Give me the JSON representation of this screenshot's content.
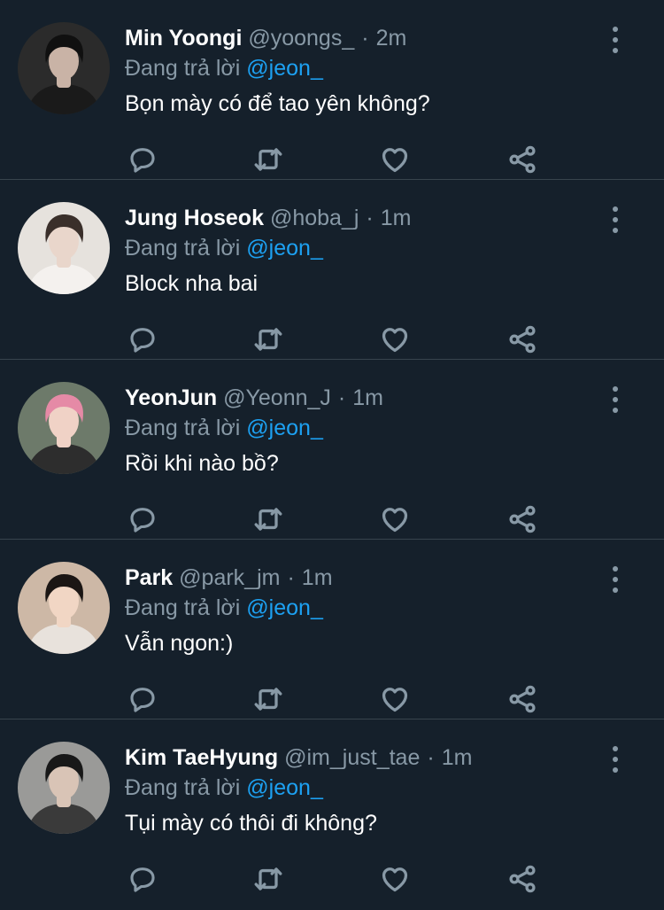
{
  "reply_prefix": "Đang trả lời",
  "time_separator": "·",
  "tweets": [
    {
      "name": "Min Yoongi",
      "handle": "@yoongs_",
      "time": "2m",
      "reply_to": "@jeon_",
      "text": "Bọn mày có để tao yên không?",
      "avatar": {
        "bg": "#2b2b2b",
        "hair": "#101010",
        "skin": "#c9b3a6",
        "shirt": "#1a1a1a"
      }
    },
    {
      "name": "Jung Hoseok",
      "handle": "@hoba_j",
      "time": "1m",
      "reply_to": "@jeon_",
      "text": "Block nha bai",
      "avatar": {
        "bg": "#e6e2dd",
        "hair": "#3a2f2a",
        "skin": "#e9d6cb",
        "shirt": "#f4f1ee"
      }
    },
    {
      "name": "YeonJun",
      "handle": "@Yeonn_J",
      "time": "1m",
      "reply_to": "@jeon_",
      "text": "Rồi khi nào bồ?",
      "avatar": {
        "bg": "#6d7a6a",
        "hair": "#e58aa6",
        "skin": "#f0d2c6",
        "shirt": "#2d2d2d"
      }
    },
    {
      "name": "Park",
      "handle": "@park_jm",
      "time": "1m",
      "reply_to": "@jeon_",
      "text": "Vẫn ngon:)",
      "avatar": {
        "bg": "#cdb8a6",
        "hair": "#1b1614",
        "skin": "#f1d6c4",
        "shirt": "#e8e2dc"
      }
    },
    {
      "name": "Kim TaeHyung",
      "handle": "@im_just_tae",
      "time": "1m",
      "reply_to": "@jeon_",
      "text": "Tụi mày có thôi đi không?",
      "avatar": {
        "bg": "#9a9a98",
        "hair": "#181818",
        "skin": "#d9c4b6",
        "shirt": "#3a3a3a"
      }
    }
  ]
}
